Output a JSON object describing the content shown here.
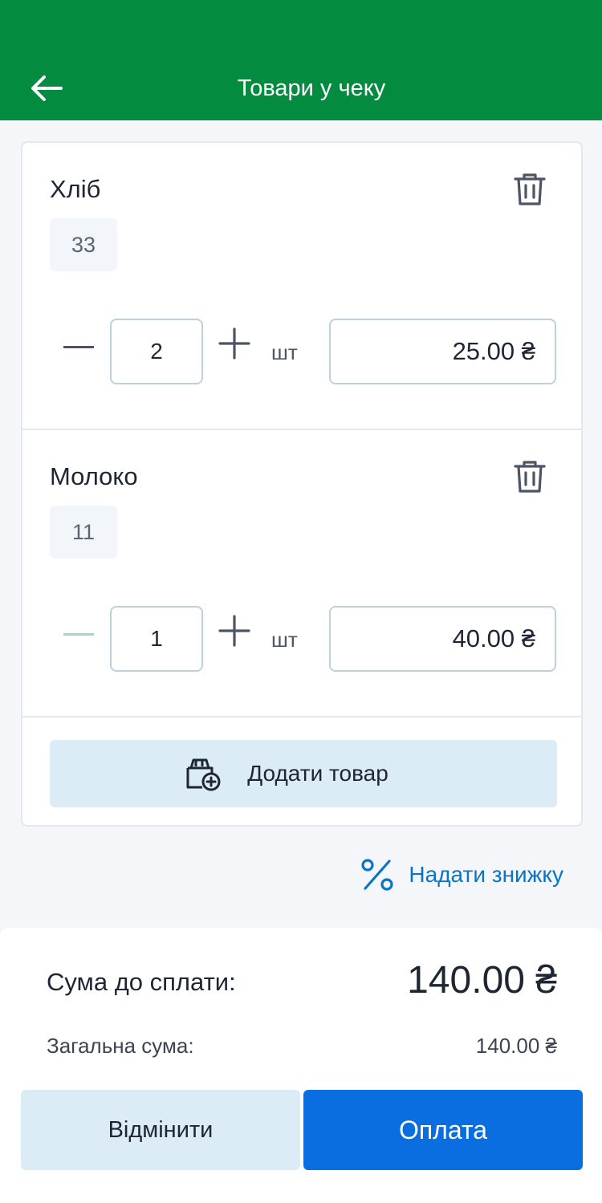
{
  "header": {
    "title": "Товари у чеку",
    "bg_color": "#038c40",
    "back_icon": "arrow-left-icon"
  },
  "items": [
    {
      "name": "Хліб",
      "code": "33",
      "quantity": "2",
      "unit": "шт",
      "price": "25.00 ₴",
      "minus_enabled": true
    },
    {
      "name": "Молоко",
      "code": "11",
      "quantity": "1",
      "unit": "шт",
      "price": "40.00 ₴",
      "minus_enabled": false
    }
  ],
  "add_item": {
    "label": "Додати товар",
    "icon": "add-box-icon"
  },
  "discount": {
    "label": "Надати знижку",
    "icon": "percent-icon",
    "color": "#0c74c4"
  },
  "summary": {
    "due_label": "Сума до сплати:",
    "due_value": "140.00 ₴",
    "total_label": "Загальна сума:",
    "total_value": "140.00 ₴"
  },
  "actions": {
    "cancel_label": "Відмінити",
    "pay_label": "Оплата",
    "pay_color": "#0a6ee0"
  }
}
